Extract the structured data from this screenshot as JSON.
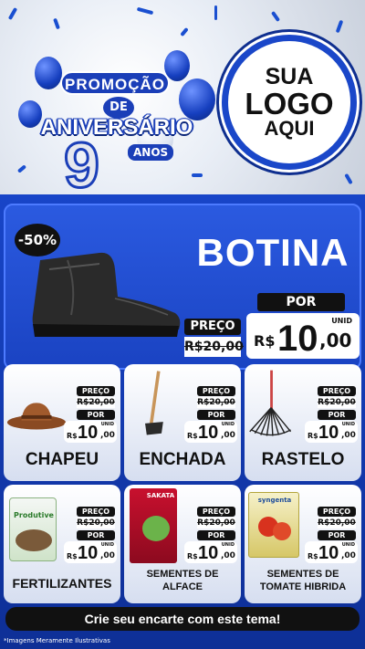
{
  "header": {
    "promo_word": "PROMOÇÃO",
    "de_word": "DE",
    "aniversario_word": "ANIVERSÁRIO",
    "age_number": "9",
    "anos_word": "ANOS",
    "logo_line1": "SUA",
    "logo_line2": "LOGO",
    "logo_line3": "AQUI"
  },
  "hero": {
    "discount": "-50%",
    "title": "BOTINA",
    "preco_label": "PREÇO",
    "old_price": "R$20,00",
    "por_label": "POR",
    "currency": "R$",
    "new_int": "10",
    "new_cents": ",00",
    "unit": "UNID"
  },
  "products": [
    {
      "name": "CHAPEU",
      "preco_label": "PREÇO",
      "old_price": "R$20,00",
      "por_label": "POR",
      "currency": "R$",
      "new_int": "10",
      "new_cents": ",00",
      "unit": "UNID"
    },
    {
      "name": "ENCHADA",
      "preco_label": "PREÇO",
      "old_price": "R$20,00",
      "por_label": "POR",
      "currency": "R$",
      "new_int": "10",
      "new_cents": ",00",
      "unit": "UNID"
    },
    {
      "name": "RASTELO",
      "preco_label": "PREÇO",
      "old_price": "R$20,00",
      "por_label": "POR",
      "currency": "R$",
      "new_int": "10",
      "new_cents": ",00",
      "unit": "UNID"
    },
    {
      "name": "FERTILIZANTES",
      "preco_label": "PREÇO",
      "old_price": "R$20,00",
      "por_label": "POR",
      "currency": "R$",
      "new_int": "10",
      "new_cents": ",00",
      "unit": "UNID",
      "package_text": "Produtive"
    },
    {
      "name_line1": "SEMENTES DE",
      "name_line2": "ALFACE",
      "preco_label": "PREÇO",
      "old_price": "R$20,00",
      "por_label": "POR",
      "currency": "R$",
      "new_int": "10",
      "new_cents": ",00",
      "unit": "UNID",
      "package_text": "SAKATA"
    },
    {
      "name_line1": "SEMENTES DE",
      "name_line2": "TOMATE HIBRIDA",
      "preco_label": "PREÇO",
      "old_price": "R$20,00",
      "por_label": "POR",
      "currency": "R$",
      "new_int": "10",
      "new_cents": ",00",
      "unit": "UNID",
      "package_text": "syngenta"
    }
  ],
  "footer": {
    "cta": "Crie seu encarte com este tema!",
    "disclaimer": "*Imagens Meramente Ilustrativas"
  },
  "colors": {
    "brand_blue": "#1845c8",
    "dark": "#111111",
    "white": "#ffffff"
  }
}
